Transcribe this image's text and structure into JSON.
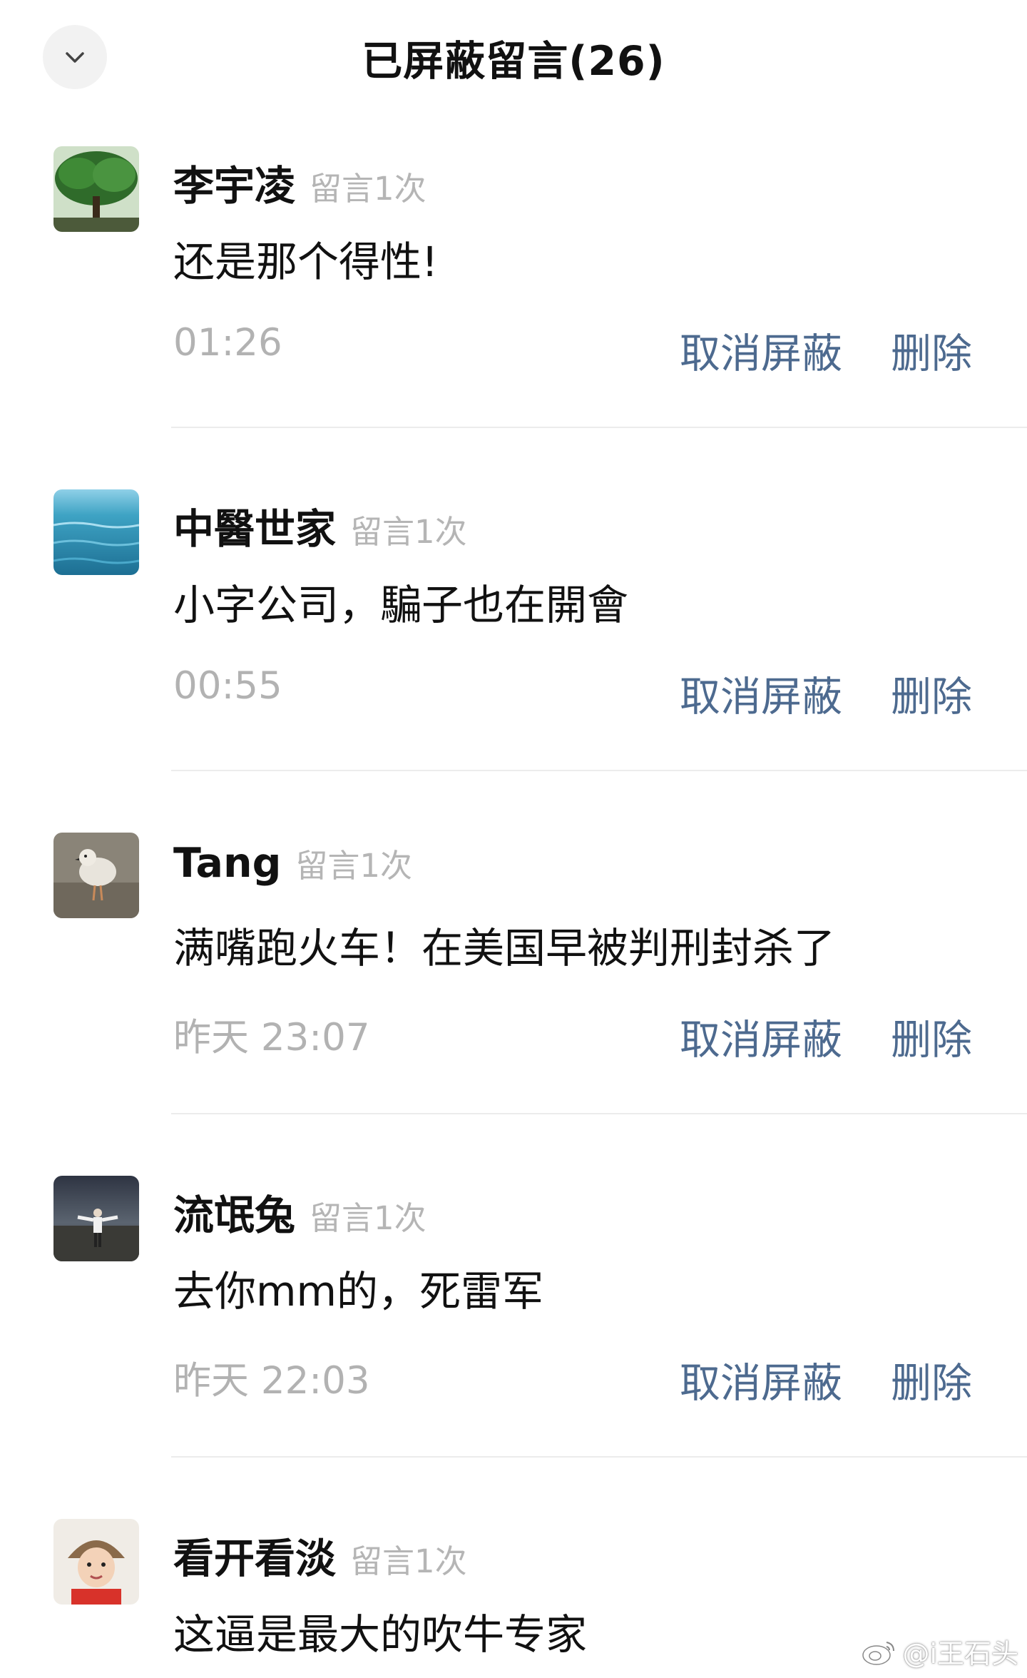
{
  "header": {
    "title": "已屏蔽留言(26)"
  },
  "comments": [
    {
      "name": "李宇凌",
      "count": "留言1次",
      "content": "还是那个得性!",
      "time": "01:26",
      "unblock_label": "取消屏蔽",
      "delete_label": "删除",
      "avatar": "tree-photo"
    },
    {
      "name": "中醫世家",
      "count": "留言1次",
      "content": "小字公司，騙子也在開會",
      "time": "00:55",
      "unblock_label": "取消屏蔽",
      "delete_label": "删除",
      "avatar": "sea-photo"
    },
    {
      "name": "Tang",
      "count": "留言1次",
      "content": "满嘴跑火车！在美国早被判刑封杀了",
      "time": "昨天 23:07",
      "unblock_label": "取消屏蔽",
      "delete_label": "删除",
      "avatar": "bird-photo"
    },
    {
      "name": "流氓兔",
      "count": "留言1次",
      "content": "去你mm的，死雷军",
      "time": "昨天 22:03",
      "unblock_label": "取消屏蔽",
      "delete_label": "删除",
      "avatar": "beach-person-photo"
    },
    {
      "name": "看开看淡",
      "count": "留言1次",
      "content": "这逼是最大的吹牛专家",
      "time": "",
      "unblock_label": "",
      "delete_label": "",
      "avatar": "child-photo"
    }
  ],
  "watermark": {
    "text": "@i王石头"
  },
  "colors": {
    "action": "#4d6a8f",
    "muted": "#b2b2b2",
    "divider": "#ececec"
  }
}
